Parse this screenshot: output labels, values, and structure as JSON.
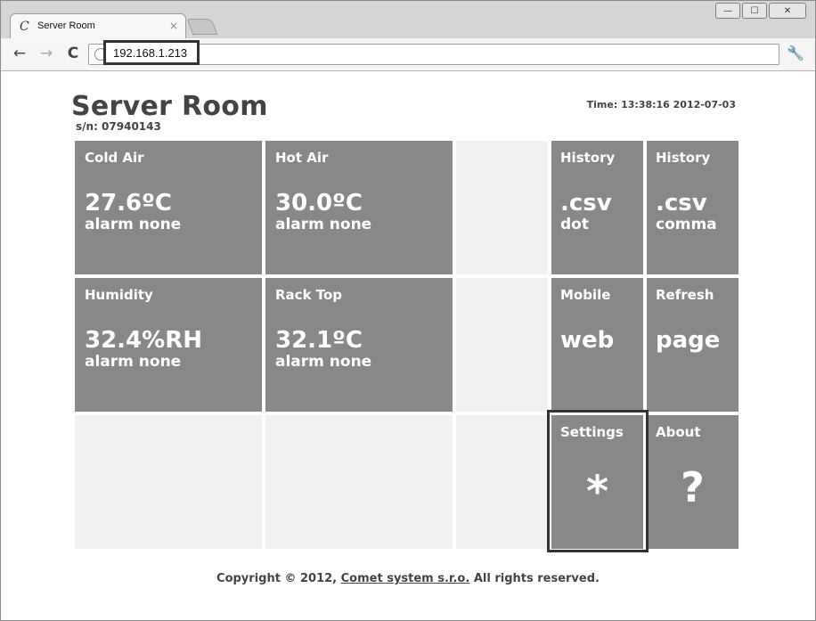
{
  "browser": {
    "tab_title": "Server Room",
    "tab_close": "×",
    "url": "192.168.1.213",
    "nav": {
      "back": "←",
      "forward": "→",
      "reload": "C"
    },
    "window_controls": {
      "minimize": "—",
      "maximize": "☐",
      "close": "✕"
    },
    "icons": {
      "favicon": "comet-c-icon",
      "settings": "wrench-icon",
      "site": "globe-icon"
    }
  },
  "header": {
    "title": "Server Room",
    "serial": "s/n: 07940143",
    "time": "Time: 13:38:16 2012-07-03"
  },
  "tiles": {
    "cold_air": {
      "label": "Cold Air",
      "value": "27.6ºC",
      "status": "alarm none"
    },
    "hot_air": {
      "label": "Hot Air",
      "value": "30.0ºC",
      "status": "alarm none"
    },
    "history_dot": {
      "label": "History",
      "value": ".csv",
      "status": "dot"
    },
    "history_comma": {
      "label": "History",
      "value": ".csv",
      "status": "comma"
    },
    "humidity": {
      "label": "Humidity",
      "value": "32.4%RH",
      "status": "alarm none"
    },
    "rack_top": {
      "label": "Rack Top",
      "value": "32.1ºC",
      "status": "alarm none"
    },
    "mobile": {
      "label": "Mobile",
      "value": "web"
    },
    "refresh": {
      "label": "Refresh",
      "value": "page"
    },
    "settings": {
      "label": "Settings",
      "symbol": "*"
    },
    "about": {
      "label": "About",
      "symbol": "?"
    }
  },
  "colors": {
    "tile": "#888888",
    "empty_tile": "#f1f1f1",
    "text": "#444444"
  },
  "footer": {
    "prefix": "Copyright © 2012, ",
    "link": "Comet system s.r.o.",
    "suffix": " All rights reserved."
  }
}
